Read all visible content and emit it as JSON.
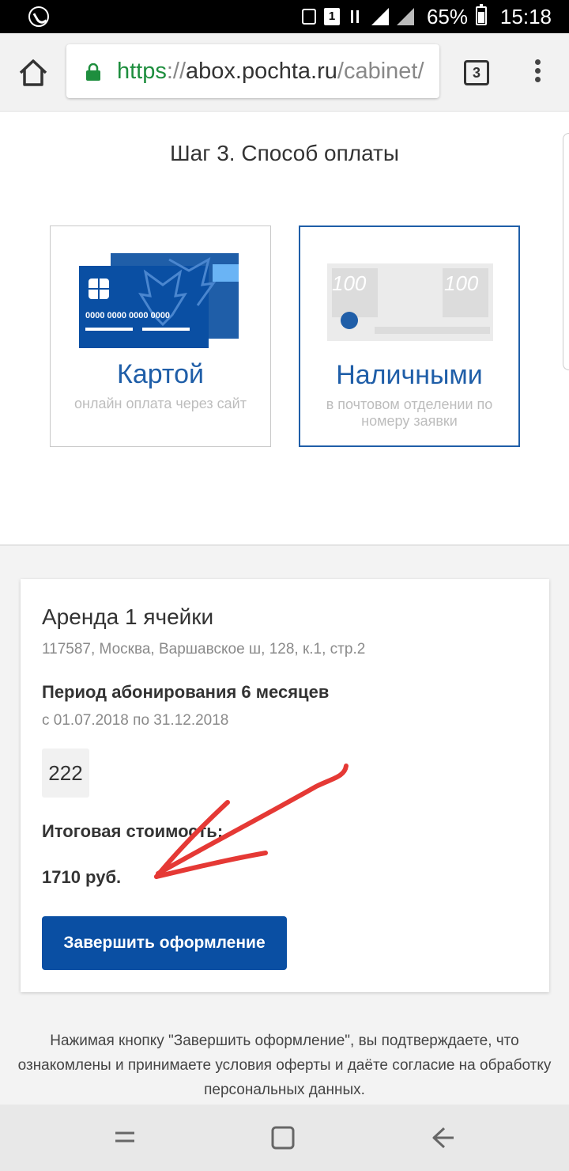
{
  "status_bar": {
    "battery": "65%",
    "time": "15:18"
  },
  "browser": {
    "url_scheme": "https",
    "url_sep": "://",
    "url_host": "abox.pochta.ru",
    "url_path": "/cabinet/",
    "tab_count": "3"
  },
  "page": {
    "step_title": "Шаг 3. Способ оплаты",
    "payment_options": [
      {
        "label": "Картой",
        "sub": "онлайн оплата через сайт",
        "card_number": "0000  0000  0000  0000"
      },
      {
        "label": "Наличными",
        "sub": "в почтовом отделении по номеру заявки",
        "denomination": "100"
      }
    ],
    "summary": {
      "title": "Аренда 1 ячейки",
      "address": "117587, Москва, Варшавское ш, 128, к.1, стр.2",
      "period_label": "Период абонирования 6 месяцев",
      "period_dates": "с 01.07.2018 по 31.12.2018",
      "cell_number": "222",
      "total_label": "Итоговая стоимость:",
      "total_value": "1710 руб.",
      "finish_button": "Завершить оформление"
    },
    "disclaimer": "Нажимая кнопку \"Завершить оформление\", вы подтверждаете, что ознакомлены и принимаете условия оферты и даёте согласие на обработку персональных данных."
  },
  "colors": {
    "brand_blue": "#0a4fa3",
    "accent_blue": "#1f5ea8",
    "url_green": "#1e8e3e",
    "annotation_red": "#e53935"
  },
  "icons": {
    "home": "home-icon",
    "lock": "lock-icon",
    "tabs": "tabs-icon",
    "menu": "more-vert-icon",
    "nav_recent": "recent-apps-icon",
    "nav_home": "home-square-icon",
    "nav_back": "back-arrow-icon"
  }
}
